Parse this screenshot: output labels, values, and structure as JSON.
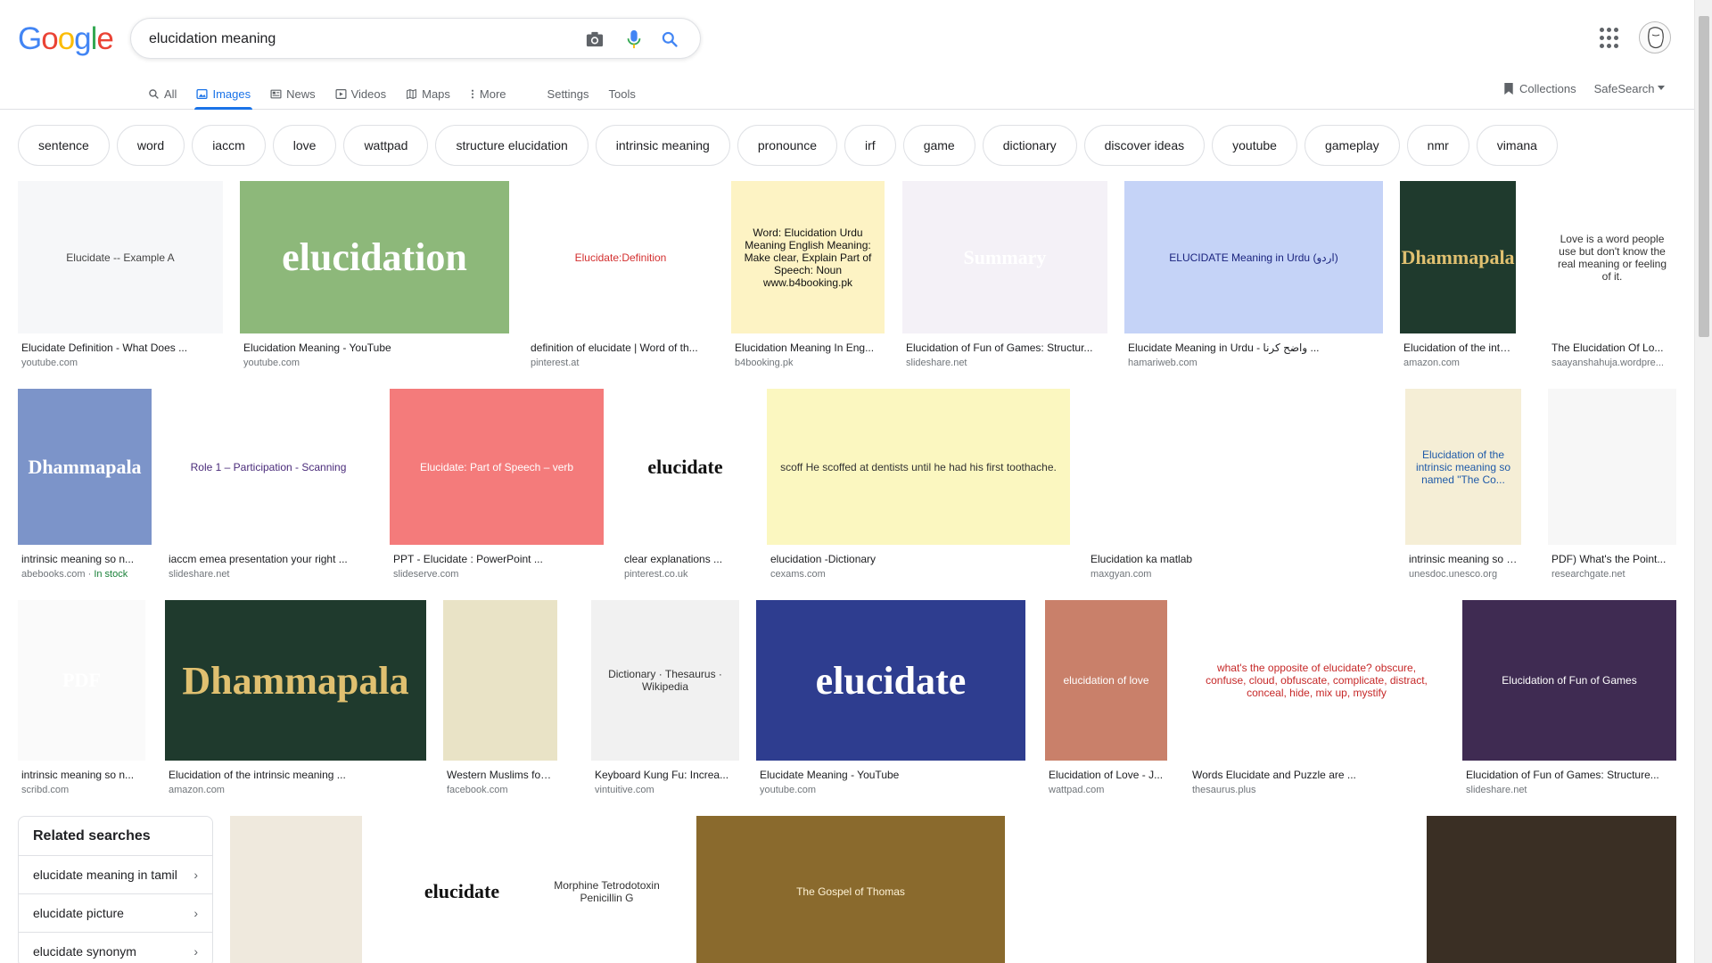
{
  "brand": {
    "letters": [
      "G",
      "o",
      "o",
      "g",
      "l",
      "e"
    ],
    "colors": [
      "#4285F4",
      "#EA4335",
      "#FBBC05",
      "#4285F4",
      "#34A853",
      "#EA4335"
    ]
  },
  "search": {
    "query": "elucidation meaning"
  },
  "tabs": [
    {
      "label": "All",
      "icon": "search-icon"
    },
    {
      "label": "Images",
      "icon": "image-icon"
    },
    {
      "label": "News",
      "icon": "news-icon"
    },
    {
      "label": "Videos",
      "icon": "video-icon"
    },
    {
      "label": "Maps",
      "icon": "map-icon"
    },
    {
      "label": "More",
      "icon": "more-vert-icon"
    },
    {
      "label": "Settings"
    },
    {
      "label": "Tools"
    }
  ],
  "right_tools": {
    "collections": "Collections",
    "safesearch": "SafeSearch"
  },
  "chips": [
    "sentence",
    "word",
    "iaccm",
    "love",
    "wattpad",
    "structure elucidation",
    "intrinsic meaning",
    "pronounce",
    "irf",
    "game",
    "dictionary",
    "discover ideas",
    "youtube",
    "gameplay",
    "nmr",
    "vimana"
  ],
  "results": [
    {
      "title": "Elucidate Definition - What Does ...",
      "source": "youtube.com",
      "thumb_text": "Elucidate -- Example A",
      "bg": "#f6f7f9",
      "fg": "#444"
    },
    {
      "title": "Elucidation Meaning - YouTube",
      "source": "youtube.com",
      "thumb_text": "elucidation",
      "bg": "#8db87a",
      "fg": "#fff"
    },
    {
      "title": "definition of elucidate | Word of th...",
      "source": "pinterest.at",
      "thumb_text": "Elucidate:Definition",
      "bg": "#ffffff",
      "fg": "#d32f2f"
    },
    {
      "title": "Elucidation Meaning In Eng...",
      "source": "b4booking.pk",
      "thumb_text": "Word: Elucidation Urdu Meaning English Meaning: Make clear, Explain Part of Speech: Noun www.b4booking.pk",
      "bg": "#fdf3c4",
      "fg": "#111"
    },
    {
      "title": "Elucidation of Fun of Games: Structur...",
      "source": "slideshare.net",
      "thumb_text": "Summary",
      "bg": "#f4f1f7",
      "fg": "#fff"
    },
    {
      "title": "Elucidate Meaning in Urdu - واضح کرنا ...",
      "source": "hamariweb.com",
      "thumb_text": "ELUCIDATE Meaning in Urdu (اردو)",
      "bg": "#c5d3f7",
      "fg": "#1a237e"
    },
    {
      "title": "Elucidation of the intri...",
      "source": "amazon.com",
      "thumb_text": "Dhammapala",
      "bg": "#1f3a2d",
      "fg": "#e0c070"
    },
    {
      "title": "The Elucidation Of Lo...",
      "source": "saayanshahuja.wordpre...",
      "thumb_text": "Love is a word people use but don't know the real meaning or feeling of it.",
      "bg": "#ffffff",
      "fg": "#333"
    },
    {
      "title": "intrinsic meaning so n...",
      "source": "abebooks.com",
      "source_extra": "In stock",
      "thumb_text": "Dhammapala",
      "bg": "#7c94c9",
      "fg": "#fff"
    },
    {
      "title": "iaccm emea presentation your right ...",
      "source": "slideshare.net",
      "thumb_text": "Role 1 – Participation - Scanning",
      "bg": "#ffffff",
      "fg": "#4a2b7a"
    },
    {
      "title": "PPT - Elucidate : PowerPoint ...",
      "source": "slideserve.com",
      "thumb_text": "Elucidate: Part of Speech – verb",
      "bg": "#f47b7b",
      "fg": "#fff"
    },
    {
      "title": "clear explanations ...",
      "source": "pinterest.co.uk",
      "thumb_text": "elucidate",
      "bg": "#ffffff",
      "fg": "#111"
    },
    {
      "title": "elucidation -Dictionary",
      "source": "cexams.com",
      "thumb_text": "scoff  He scoffed at dentists until he had his first toothache.",
      "bg": "#fbf7c0",
      "fg": "#333"
    },
    {
      "title": "Elucidation ka matlab",
      "source": "maxgyan.com",
      "thumb_text": "",
      "bg": "#ffffff",
      "fg": "#3b6bd6"
    },
    {
      "title": "intrinsic meaning so n...",
      "source": "unesdoc.unesco.org",
      "thumb_text": "Elucidation of the intrinsic meaning so named \"The Co...",
      "bg": "#f5eed6",
      "fg": "#1f5aa8"
    },
    {
      "title": "PDF) What's the Point...",
      "source": "researchgate.net",
      "thumb_text": "",
      "bg": "#f7f7f7",
      "fg": "#777"
    },
    {
      "title": "intrinsic meaning so n...",
      "source": "scribd.com",
      "thumb_text": "PDF",
      "bg": "#fafafa",
      "fg": "#fff"
    },
    {
      "title": "Elucidation of the intrinsic meaning ...",
      "source": "amazon.com",
      "thumb_text": "Dhammapala",
      "bg": "#1f3a2d",
      "fg": "#e0c070"
    },
    {
      "title": "Western Muslims for E...",
      "source": "facebook.com",
      "thumb_text": "",
      "bg": "#e9e3c6",
      "fg": "#333"
    },
    {
      "title": "Keyboard Kung Fu: Increa...",
      "source": "vintuitive.com",
      "thumb_text": "Dictionary · Thesaurus · Wikipedia",
      "bg": "#f1f1f1",
      "fg": "#333"
    },
    {
      "title": "Elucidate Meaning - YouTube",
      "source": "youtube.com",
      "thumb_text": "elucidate",
      "bg": "#2e3d8f",
      "fg": "#fff"
    },
    {
      "title": "Elucidation of Love - J...",
      "source": "wattpad.com",
      "thumb_text": "elucidation of love",
      "bg": "#c9806a",
      "fg": "#fff"
    },
    {
      "title": "Words Elucidate and Puzzle are ...",
      "source": "thesaurus.plus",
      "thumb_text": "what's the opposite of elucidate?   obscure, confuse, cloud, obfuscate, complicate, distract, conceal, hide, mix up, mystify",
      "bg": "#ffffff",
      "fg": "#c62828"
    },
    {
      "title": "Elucidation of Fun of Games: Structure...",
      "source": "slideshare.net",
      "thumb_text": "Elucidation of Fun of Games",
      "bg": "#3f2b52",
      "fg": "#fff"
    },
    {
      "title": "",
      "source": "",
      "thumb_text": "",
      "bg": "#efe9dd",
      "fg": "#555"
    },
    {
      "title": "",
      "source": "",
      "thumb_text": "elucidate",
      "bg": "#ffffff",
      "fg": "#111"
    },
    {
      "title": "",
      "source": "",
      "thumb_text": "Morphine   Tetrodotoxin   Penicillin G",
      "bg": "#ffffff",
      "fg": "#333"
    },
    {
      "title": "",
      "source": "",
      "thumb_text": "The Gospel of Thomas",
      "bg": "#8a6a2d",
      "fg": "#fff3d6"
    },
    {
      "title": "",
      "source": "",
      "thumb_text": "",
      "bg": "#ffffff",
      "fg": "#555"
    },
    {
      "title": "",
      "source": "",
      "thumb_text": "",
      "bg": "#ffffff",
      "fg": "#555"
    },
    {
      "title": "",
      "source": "",
      "thumb_text": "",
      "bg": "#3a2f24",
      "fg": "#fff"
    }
  ],
  "related": {
    "heading": "Related searches",
    "items": [
      "elucidate meaning in tamil",
      "elucidate picture",
      "elucidate synonym"
    ]
  }
}
